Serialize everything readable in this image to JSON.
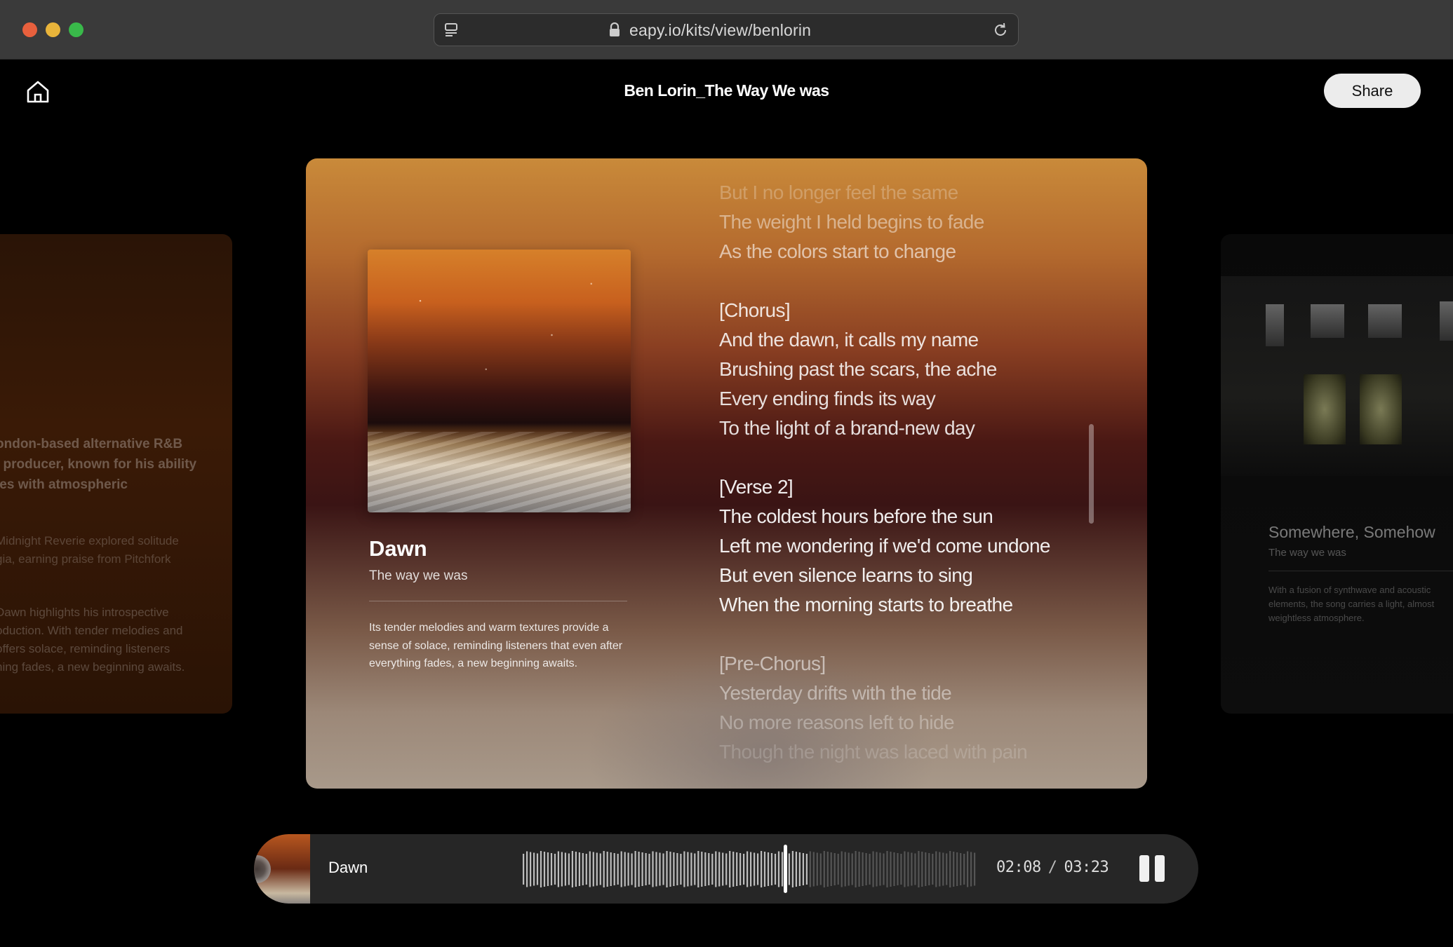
{
  "browser": {
    "url": "eapy.io/kits/view/benlorin"
  },
  "header": {
    "title": "Ben Lorin_The Way We was",
    "share_label": "Share"
  },
  "left_card": {
    "bio_lines": [
      "ondon-based alternative R&B",
      "l producer, known for his ability",
      "ies with atmospheric"
    ],
    "para2_lines": [
      "Midnight Reverie explored solitude",
      "gia, earning praise from Pitchfork",
      "."
    ],
    "para3_lines": [
      "Dawn highlights his introspective",
      "oduction. With tender melodies and",
      " offers solace, reminding listeners",
      "hing fades, a new beginning awaits."
    ]
  },
  "right_card": {
    "title": "Somewhere, Somehow",
    "album": "The way we was",
    "description": "With a fusion of synthwave and acoustic elements, the song carries a light, almost weightless atmosphere."
  },
  "main_card": {
    "song_title": "Dawn",
    "album": "The way we was",
    "description": "Its tender melodies and warm textures provide a sense of solace, reminding listeners that even after everything fades, a new beginning awaits.",
    "lyrics": [
      {
        "text": "But I no longer feel the same",
        "opacity": 0.25
      },
      {
        "text": "The weight I held begins to fade",
        "opacity": 0.45
      },
      {
        "text": "As the colors start to change",
        "opacity": 0.6
      },
      {
        "text": "",
        "opacity": 0
      },
      {
        "text": "[Chorus]",
        "opacity": 0.85
      },
      {
        "text": "And the dawn, it calls my name",
        "opacity": 0.85
      },
      {
        "text": "Brushing past the scars, the ache",
        "opacity": 0.85
      },
      {
        "text": "Every ending finds its way",
        "opacity": 0.85
      },
      {
        "text": "To the light of a brand-new day",
        "opacity": 0.85
      },
      {
        "text": "",
        "opacity": 0
      },
      {
        "text": "[Verse 2]",
        "opacity": 0.92
      },
      {
        "text": "The coldest hours before the sun",
        "opacity": 0.92
      },
      {
        "text": "Left me wondering if we'd come undone",
        "opacity": 0.92
      },
      {
        "text": "But even silence learns to sing",
        "opacity": 0.92
      },
      {
        "text": "When the morning starts to breathe",
        "opacity": 0.92
      },
      {
        "text": "",
        "opacity": 0
      },
      {
        "text": "[Pre-Chorus]",
        "opacity": 0.55
      },
      {
        "text": "Yesterday drifts with the tide",
        "opacity": 0.45
      },
      {
        "text": "No more reasons left to hide",
        "opacity": 0.32
      },
      {
        "text": "Though the night was laced with pain",
        "opacity": 0.18
      }
    ]
  },
  "player": {
    "track_title": "Dawn",
    "current_time": "02:08",
    "separator": "/",
    "total_time": "03:23",
    "progress": 0.63
  },
  "colors": {
    "accent_orange": "#c98a3a",
    "background": "#000000"
  },
  "icons": [
    "home-icon",
    "tab-overview-icon",
    "lock-icon",
    "reload-icon",
    "pause-icon"
  ]
}
